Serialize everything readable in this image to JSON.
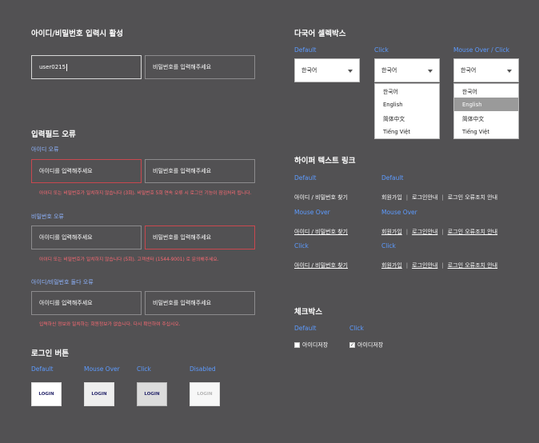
{
  "login_input": {
    "title": "아이디/비밀번호 입력시 활성",
    "id_value": "user0215",
    "pw_placeholder": "비밀번호를 입력해주세요"
  },
  "field_errors": {
    "title": "입력필드 오류",
    "id_error": {
      "label": "아이디 오류",
      "id_placeholder": "아이디를 입력해주세요",
      "pw_placeholder": "비밀번호를 입력해주세요",
      "message": "아이디 또는 비밀번호가 일치하지 않습니다 (3회). 비밀번호 5회 연속 오류 시 로그인 기능이 잠김처리 됩니다."
    },
    "pw_error": {
      "label": "비밀번호 오류",
      "id_placeholder": "아이디를 입력해주세요",
      "pw_placeholder": "비밀번호를 입력해주세요",
      "message": "아이디 또는 비밀번호가 일치하지 않습니다 (5회). 고객센터 (1544-9001) 로 문의해주세요."
    },
    "both_error": {
      "label": "아이디/비밀번호 둘다 오류",
      "id_placeholder": "아이디를 입력해주세요",
      "pw_placeholder": "비밀번호를 입력해주세요",
      "message": "입력하신 정보와 일치하는 회원정보가 없습니다. 다시 확인하여 주십시오."
    }
  },
  "login_buttons": {
    "title": "로그인 버튼",
    "states": [
      "Default",
      "Mouse Over",
      "Click",
      "Disabled"
    ],
    "label": "LOGIN"
  },
  "language_select": {
    "title": "다국어 셀렉박스",
    "states": [
      "Default",
      "Click",
      "Mouse Over / Click"
    ],
    "selected": "한국어",
    "options": [
      "한국어",
      "English",
      "简体中文",
      "Tiếng Việt"
    ],
    "hovered_option": "English"
  },
  "hyper_links": {
    "title": "하이퍼 텍스트 링크",
    "rows": [
      {
        "state_left": "Default",
        "state_right": "Default"
      },
      {
        "state_left": "Mouse Over",
        "state_right": "Mouse Over"
      },
      {
        "state_left": "Click",
        "state_right": "Click"
      }
    ],
    "find_id_pw": "아이디 / 비밀번호 찾기",
    "signup": "회원가입",
    "login_guide": "로그인안내",
    "login_error_guide": "로그인 오류조치 안내"
  },
  "checkbox": {
    "title": "체크박스",
    "states": [
      "Default",
      "Click"
    ],
    "label": "아이디저장",
    "checked": [
      false,
      true
    ]
  }
}
